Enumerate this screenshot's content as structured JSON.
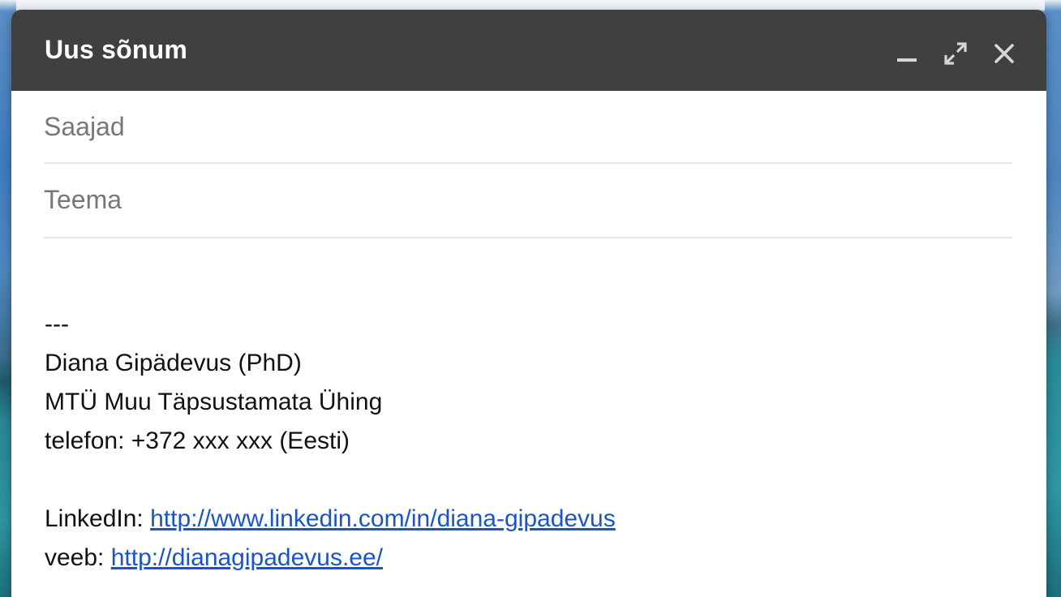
{
  "window": {
    "title": "Uus sõnum",
    "actions": {
      "minimize_icon": "minimize-icon",
      "expand_icon": "expand-icon",
      "close_icon": "close-icon"
    }
  },
  "fields": {
    "to": {
      "placeholder": "Saajad",
      "value": ""
    },
    "subject": {
      "placeholder": "Teema",
      "value": ""
    }
  },
  "signature": {
    "separator": "---",
    "name": "Diana Gipädevus (PhD)",
    "organization": "MTÜ Muu Täpsustamata Ühing",
    "phone": "telefon: +372 xxx xxx (Eesti)",
    "linkedin_label": "LinkedIn: ",
    "linkedin_url": "http://www.linkedin.com/in/diana-gipadevus",
    "web_label": "veeb: ",
    "web_url": "http://dianagipadevus.ee/"
  },
  "colors": {
    "titlebar": "#404040",
    "link": "#1a55c8"
  }
}
